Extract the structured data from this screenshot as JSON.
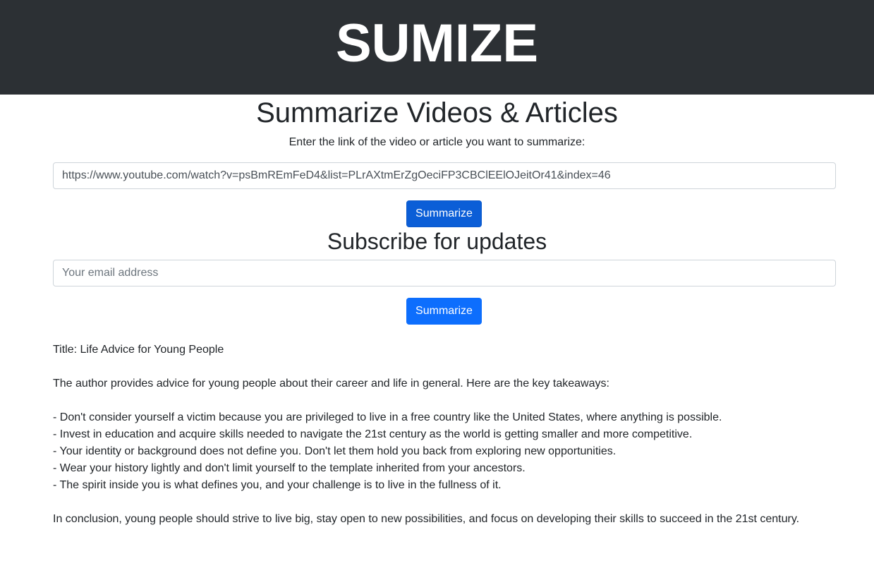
{
  "header": {
    "brand": "SUMIZE"
  },
  "main": {
    "title": "Summarize Videos & Articles",
    "prompt": "Enter the link of the video or article you want to summarize:",
    "url_value": "https://www.youtube.com/watch?v=psBmREmFeD4&list=PLrAXtmErZgOeciFP3CBClEElOJeitOr41&index=46",
    "summarize_label": "Summarize"
  },
  "subscribe": {
    "title": "Subscribe for updates",
    "email_placeholder": "Your email address",
    "button_label": "Summarize"
  },
  "summary": {
    "title_line": "Title: Life Advice for Young People",
    "intro": "The author provides advice for young people about their career and life in general. Here are the key takeaways:",
    "points": [
      "- Don't consider yourself a victim because you are privileged to live in a free country like the United States, where anything is possible.",
      "- Invest in education and acquire skills needed to navigate the 21st century as the world is getting smaller and more competitive.",
      "- Your identity or background does not define you. Don't let them hold you back from exploring new opportunities.",
      "- Wear your history lightly and don't limit yourself to the template inherited from your ancestors.",
      "- The spirit inside you is what defines you, and your challenge is to live in the fullness of it."
    ],
    "conclusion": "In conclusion, young people should strive to live big, stay open to new possibilities, and focus on developing their skills to succeed in the 21st century."
  },
  "colors": {
    "header_bg": "#2c3034",
    "primary": "#0d6efd",
    "primary_active": "#0b5ed7"
  }
}
